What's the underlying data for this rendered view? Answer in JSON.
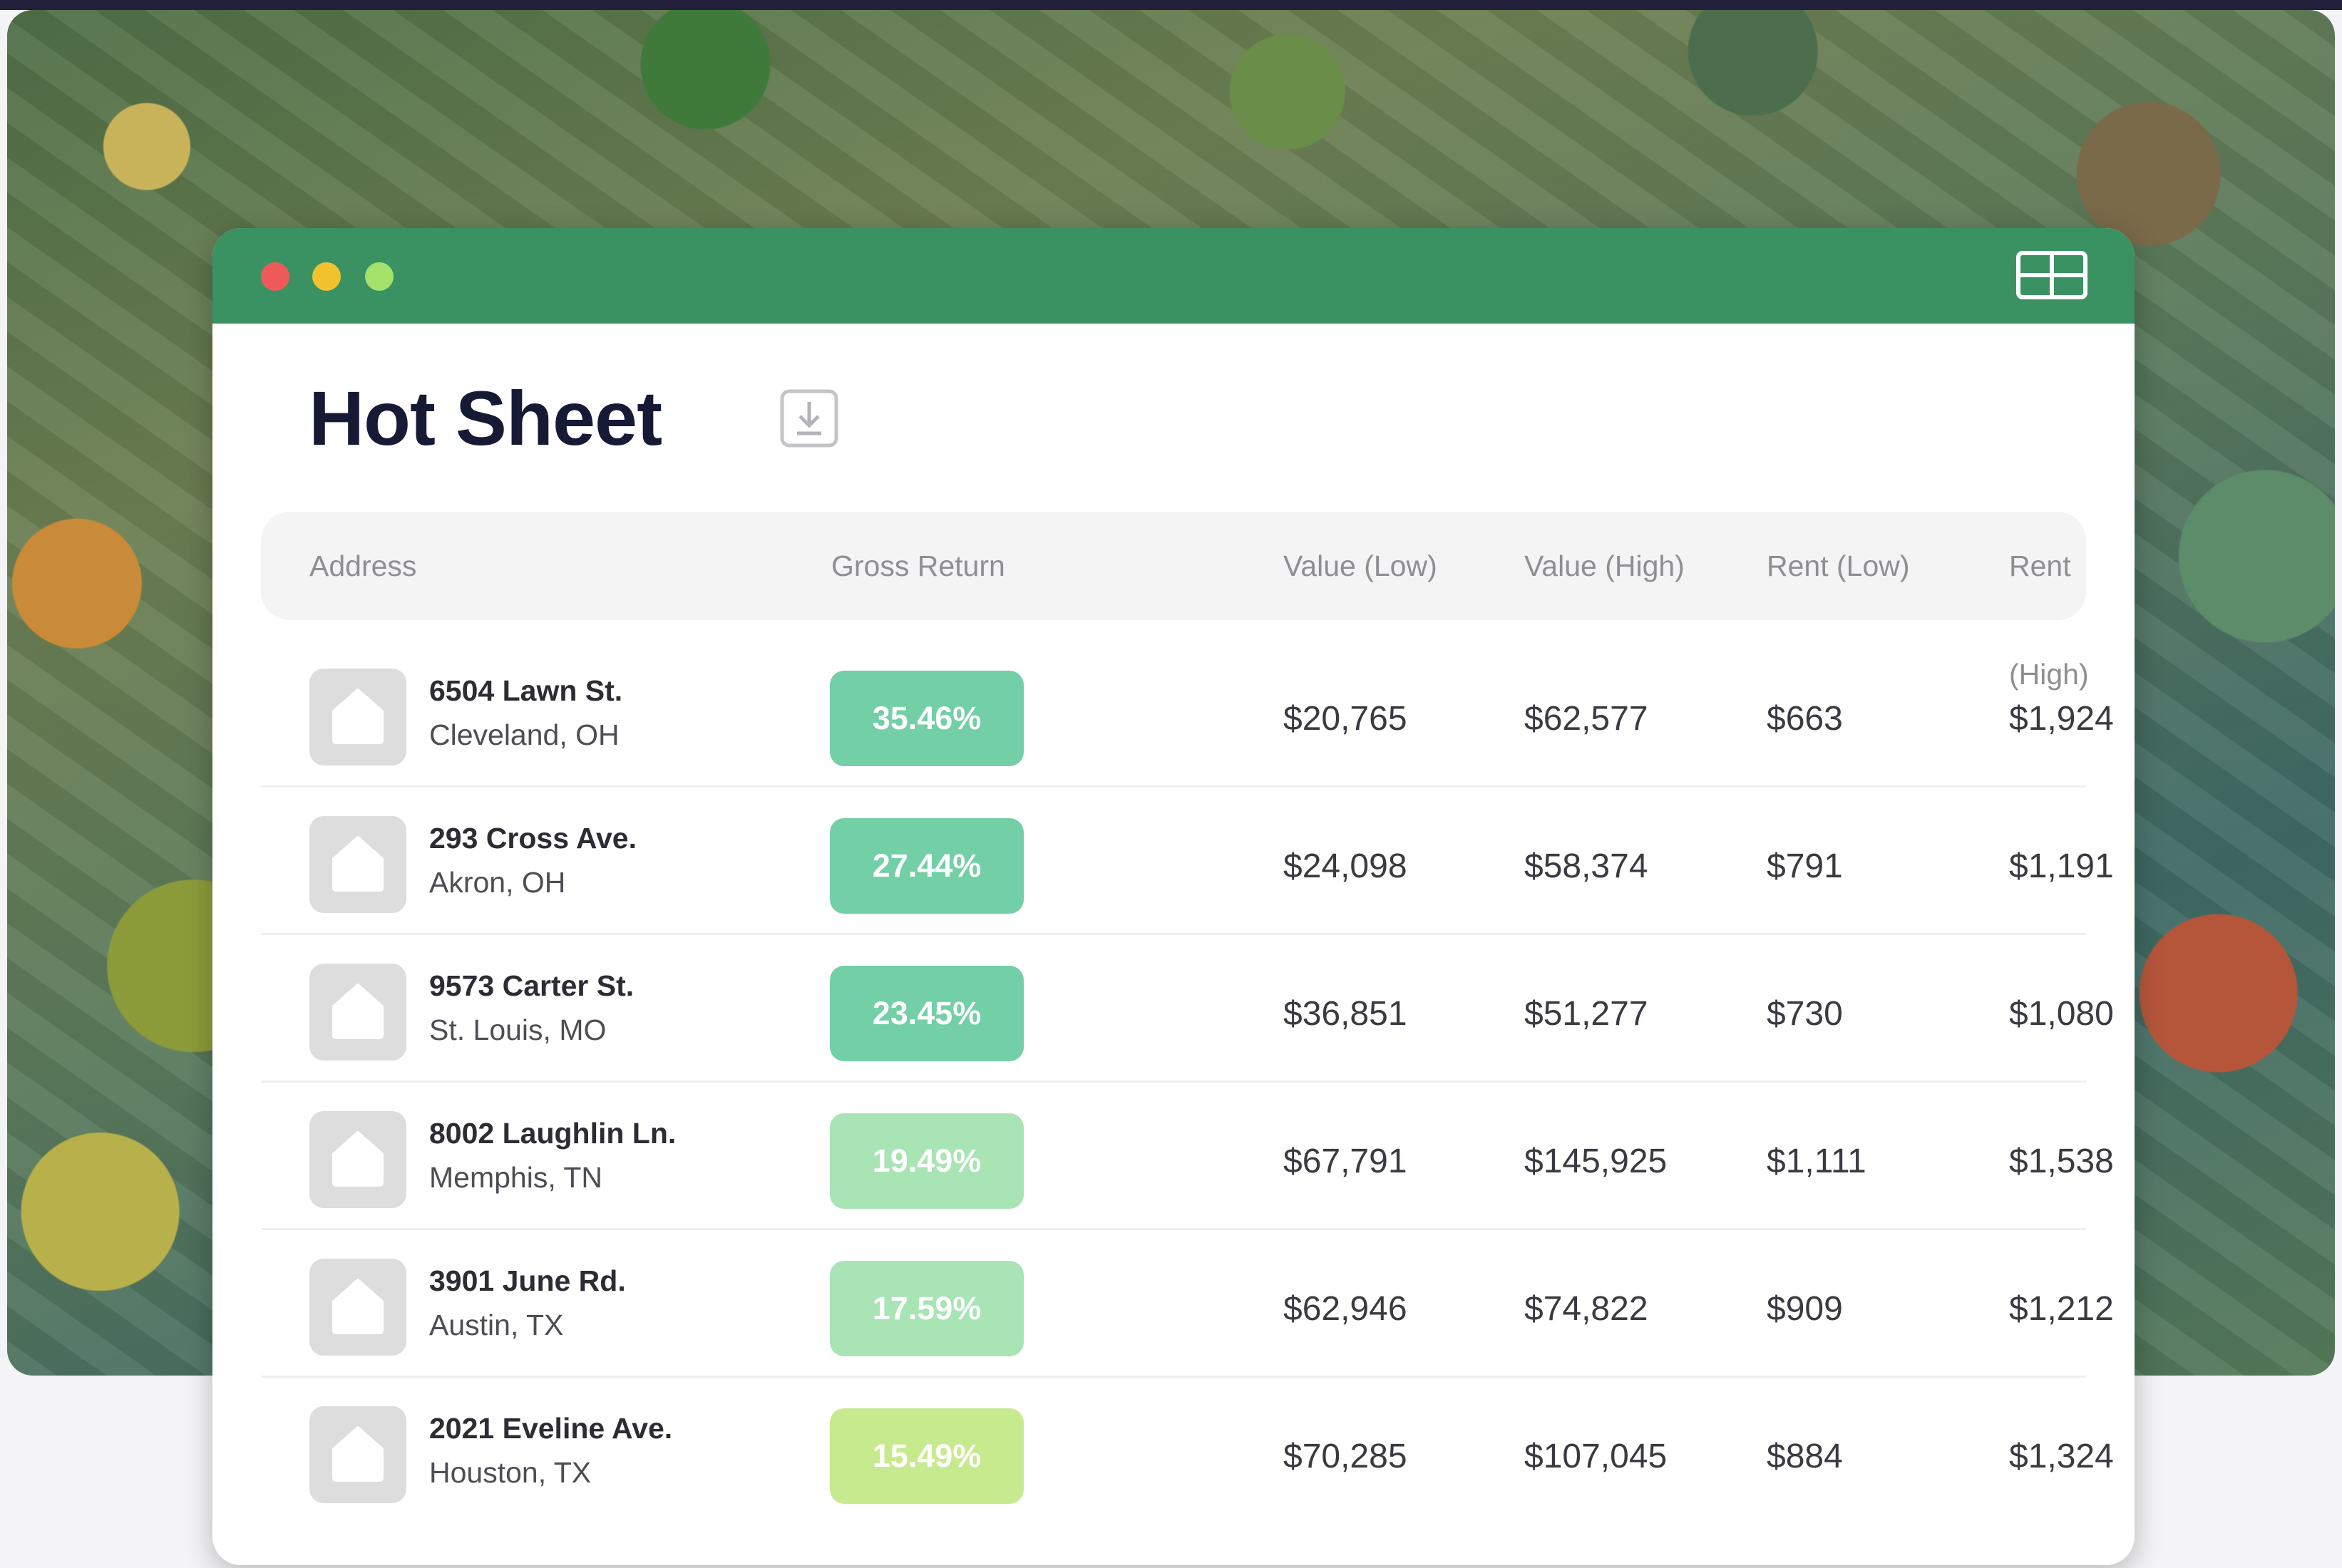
{
  "app": {
    "title": "Hot Sheet"
  },
  "colors": {
    "titlebar": "#3a9262",
    "badge_high": "#72cfa6",
    "badge_mid": "#a8e4b4",
    "badge_low": "#c8ea8e"
  },
  "icons": {
    "download": "download-icon",
    "grid": "grid-icon",
    "house": "house-icon"
  },
  "table": {
    "columns": {
      "address": "Address",
      "gross_return": "Gross Return",
      "value_low": "Value (Low)",
      "value_high": "Value (High)",
      "rent_low": "Rent (Low)",
      "rent_high": "Rent (High)"
    },
    "rows": [
      {
        "street": "6504 Lawn St.",
        "city": "Cleveland, OH",
        "gross_return": "35.46%",
        "value_low": "$20,765",
        "value_high": "$62,577",
        "rent_low": "$663",
        "rent_high": "$1,924",
        "tone": "high"
      },
      {
        "street": "293 Cross Ave.",
        "city": "Akron, OH",
        "gross_return": "27.44%",
        "value_low": "$24,098",
        "value_high": "$58,374",
        "rent_low": "$791",
        "rent_high": "$1,191",
        "tone": "high"
      },
      {
        "street": "9573 Carter St.",
        "city": "St. Louis, MO",
        "gross_return": "23.45%",
        "value_low": "$36,851",
        "value_high": "$51,277",
        "rent_low": "$730",
        "rent_high": "$1,080",
        "tone": "high"
      },
      {
        "street": "8002 Laughlin Ln.",
        "city": "Memphis, TN",
        "gross_return": "19.49%",
        "value_low": "$67,791",
        "value_high": "$145,925",
        "rent_low": "$1,111",
        "rent_high": "$1,538",
        "tone": "mid"
      },
      {
        "street": "3901 June Rd.",
        "city": "Austin, TX",
        "gross_return": "17.59%",
        "value_low": "$62,946",
        "value_high": "$74,822",
        "rent_low": "$909",
        "rent_high": "$1,212",
        "tone": "mid"
      },
      {
        "street": "2021 Eveline Ave.",
        "city": "Houston, TX",
        "gross_return": "15.49%",
        "value_low": "$70,285",
        "value_high": "$107,045",
        "rent_low": "$884",
        "rent_high": "$1,324",
        "tone": "low"
      }
    ]
  }
}
